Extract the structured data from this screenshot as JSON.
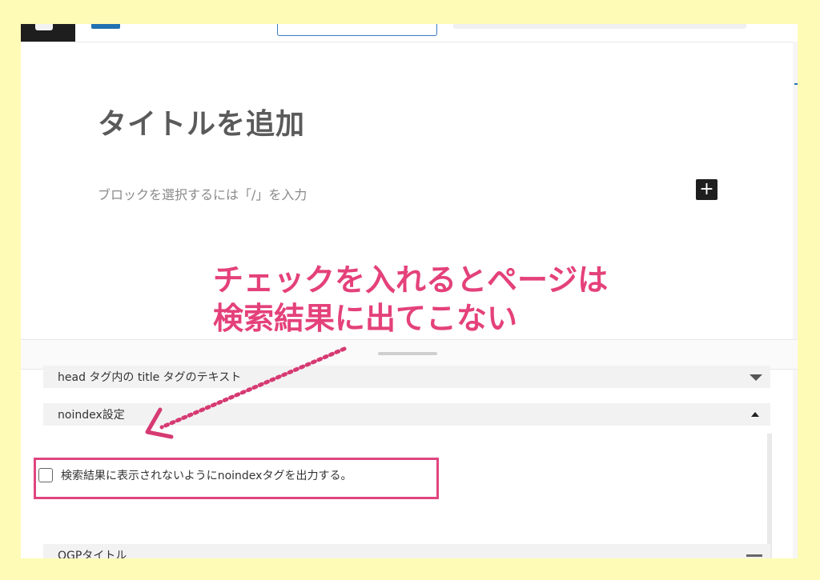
{
  "editor": {
    "title_placeholder": "タイトルを追加",
    "block_hint": "ブロックを選択するには「/」を入力",
    "add_block_symbol": "+"
  },
  "meta_panel": {
    "head_title_label": "head タグ内の title タグのテキスト",
    "noindex_label": "noindex設定",
    "noindex_checkbox_label": "検索結果に表示されないようにnoindexタグを出力する。",
    "noindex_checked": false,
    "ogp_title_label": "OGPタイトル"
  },
  "annotation": {
    "line1": "チェックを入れるとページは",
    "line2": "検索結果に出てこない",
    "color": "#e4417a"
  },
  "colors": {
    "page_background": "#fefbb6",
    "highlight": "#e0457f",
    "accent_blue": "#2271b1"
  }
}
